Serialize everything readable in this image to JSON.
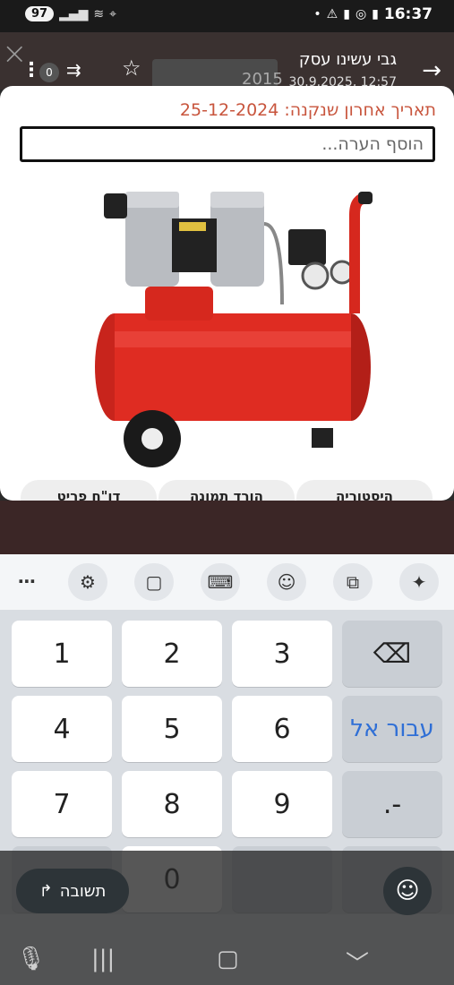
{
  "status_bar": {
    "battery": "97",
    "time": "16:37",
    "left_icons": [
      "signal-icon",
      "wifi-icon",
      "location-icon"
    ],
    "right_icons": [
      "warning-icon",
      "sim-icon",
      "whatsapp-icon",
      "signal-icon",
      "battery-icon"
    ]
  },
  "header": {
    "title": "גבי עשינו עסק",
    "subtitle": "12:57 ,30.9.2025",
    "count_badge": "0",
    "year_partial": "2015"
  },
  "modal": {
    "last_purchase": "תאריך אחרון שנקנה: 25-12-2024",
    "note_placeholder": "הוסף הערה...",
    "note_value": "",
    "buttons": [
      "היסטוריה",
      "הורד תמונה",
      "דו\"ח פריט"
    ],
    "image_subject": "red-air-compressor"
  },
  "keyboard": {
    "toolbar_icons": [
      "more-icon",
      "settings-icon",
      "clipboard-icon",
      "keyboard-icon",
      "emoji-icon",
      "translate-icon",
      "sparkle-icon"
    ],
    "rows": [
      [
        "1",
        "2",
        "3",
        "⌫"
      ],
      [
        "4",
        "5",
        "6",
        "עבור אל"
      ],
      [
        "7",
        "8",
        "9",
        ".-"
      ],
      [
        "",
        "0",
        "",
        ""
      ]
    ],
    "backspace_icon": "backspace-icon"
  },
  "bottom": {
    "reply_label": "תשובה"
  },
  "colors": {
    "accent_date": "#c8553d",
    "key_blue": "#2f6fd6"
  }
}
